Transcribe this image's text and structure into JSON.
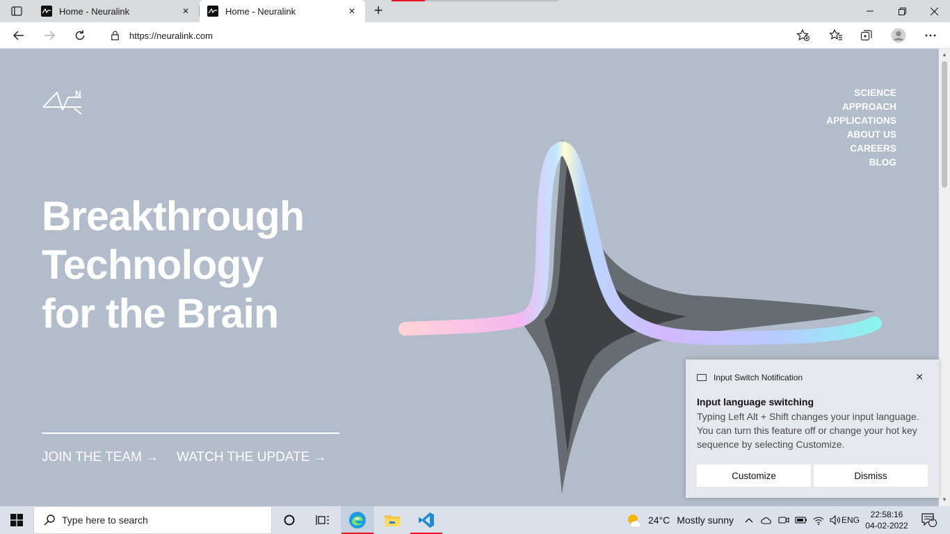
{
  "browser": {
    "tabs": [
      {
        "title": "Home - Neuralink",
        "active": false
      },
      {
        "title": "Home - Neuralink",
        "active": true
      }
    ],
    "url": "https://neuralink.com"
  },
  "site": {
    "logo_letter": "N",
    "nav": [
      "SCIENCE",
      "APPROACH",
      "APPLICATIONS",
      "ABOUT US",
      "CAREERS",
      "BLOG"
    ],
    "hero_lines": [
      "Breakthrough",
      "Technology",
      "for the Brain"
    ],
    "cta_join": "JOIN THE TEAM",
    "cta_watch": "WATCH THE UPDATE",
    "cta_arrow": "→"
  },
  "notification": {
    "app": "Input Switch Notification",
    "heading": "Input language switching",
    "body": "Typing Left Alt + Shift changes your input language. You can turn this feature off or change your hot key sequence by selecting Customize.",
    "customize": "Customize",
    "dismiss": "Dismiss"
  },
  "taskbar": {
    "search_placeholder": "Type here to search",
    "temperature": "24°C",
    "weather": "Mostly sunny",
    "language": "ENG",
    "time": "22:58:16",
    "date": "04-02-2022",
    "notification_count": "2"
  },
  "colors": {
    "page_bg": "#b2bccb",
    "accent_red": "#e81123"
  }
}
